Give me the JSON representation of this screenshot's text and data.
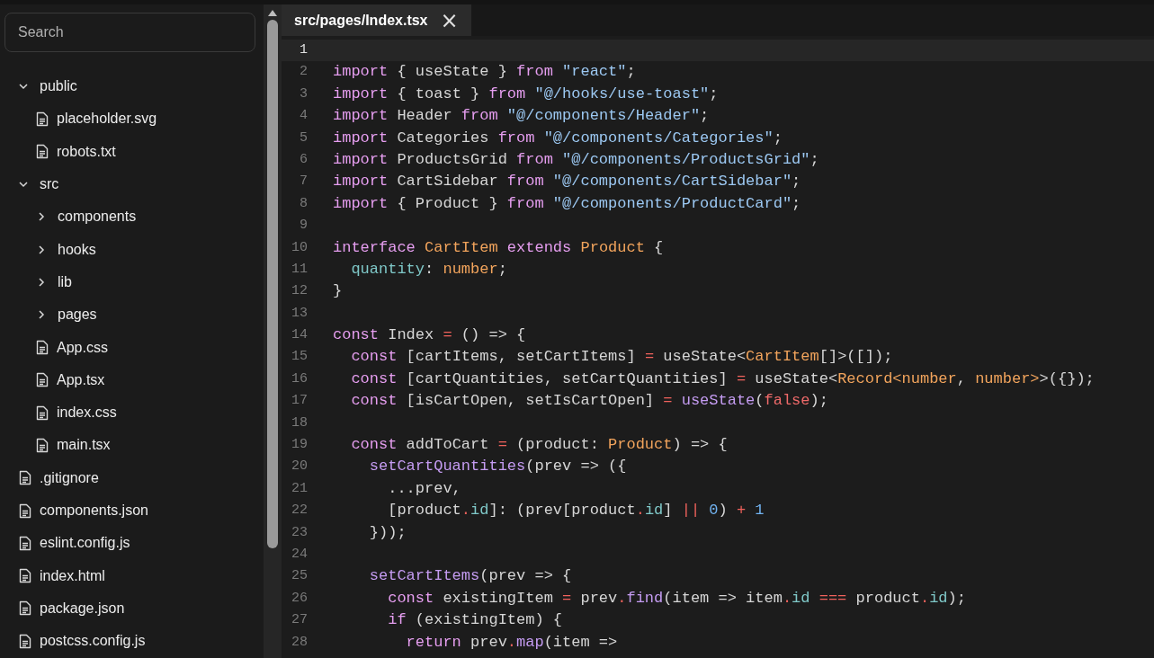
{
  "search": {
    "placeholder": "Search"
  },
  "tree": [
    {
      "kind": "folder",
      "name": "public",
      "expanded": true,
      "children": [
        {
          "kind": "file",
          "name": "placeholder.svg"
        },
        {
          "kind": "file",
          "name": "robots.txt"
        }
      ]
    },
    {
      "kind": "folder",
      "name": "src",
      "expanded": true,
      "children": [
        {
          "kind": "folder",
          "name": "components",
          "expanded": false
        },
        {
          "kind": "folder",
          "name": "hooks",
          "expanded": false
        },
        {
          "kind": "folder",
          "name": "lib",
          "expanded": false
        },
        {
          "kind": "folder",
          "name": "pages",
          "expanded": false
        },
        {
          "kind": "file",
          "name": "App.css"
        },
        {
          "kind": "file",
          "name": "App.tsx"
        },
        {
          "kind": "file",
          "name": "index.css"
        },
        {
          "kind": "file",
          "name": "main.tsx"
        }
      ]
    },
    {
      "kind": "file",
      "name": ".gitignore"
    },
    {
      "kind": "file",
      "name": "components.json"
    },
    {
      "kind": "file",
      "name": "eslint.config.js"
    },
    {
      "kind": "file",
      "name": "index.html"
    },
    {
      "kind": "file",
      "name": "package.json"
    },
    {
      "kind": "file",
      "name": "postcss.config.js"
    }
  ],
  "tabs": [
    {
      "label": "src/pages/Index.tsx",
      "selected": true,
      "close": "×"
    }
  ],
  "lines": [
    {
      "number": "1",
      "selected": true
    },
    {
      "number": "2",
      "selected": false,
      "tokens": [
        {
          "text": "import ",
          "kind": "keyword"
        },
        {
          "text": "{ useState } ",
          "kind": "plain"
        },
        {
          "text": "from ",
          "kind": "keyword"
        },
        {
          "text": "\"react\"",
          "kind": "string"
        },
        {
          "text": ";",
          "kind": "plain"
        }
      ]
    },
    {
      "number": "3",
      "selected": false,
      "tokens": [
        {
          "text": "import ",
          "kind": "keyword"
        },
        {
          "text": "{ toast } ",
          "kind": "plain"
        },
        {
          "text": "from ",
          "kind": "keyword"
        },
        {
          "text": "\"@/hooks/use-toast\"",
          "kind": "string"
        },
        {
          "text": ";",
          "kind": "plain"
        }
      ]
    },
    {
      "number": "4",
      "selected": false,
      "tokens": [
        {
          "text": "import ",
          "kind": "keyword"
        },
        {
          "text": "Header ",
          "kind": "plain"
        },
        {
          "text": "from ",
          "kind": "keyword"
        },
        {
          "text": "\"@/components/Header\"",
          "kind": "string"
        },
        {
          "text": ";",
          "kind": "plain"
        }
      ]
    },
    {
      "number": "5",
      "selected": false,
      "tokens": [
        {
          "text": "import ",
          "kind": "keyword"
        },
        {
          "text": "Categories ",
          "kind": "plain"
        },
        {
          "text": "from ",
          "kind": "keyword"
        },
        {
          "text": "\"@/components/Categories\"",
          "kind": "string"
        },
        {
          "text": ";",
          "kind": "plain"
        }
      ]
    },
    {
      "number": "6",
      "selected": false,
      "tokens": [
        {
          "text": "import ",
          "kind": "keyword"
        },
        {
          "text": "ProductsGrid ",
          "kind": "plain"
        },
        {
          "text": "from ",
          "kind": "keyword"
        },
        {
          "text": "\"@/components/ProductsGrid\"",
          "kind": "string"
        },
        {
          "text": ";",
          "kind": "plain"
        }
      ]
    },
    {
      "number": "7",
      "selected": false,
      "tokens": [
        {
          "text": "import ",
          "kind": "keyword"
        },
        {
          "text": "CartSidebar ",
          "kind": "plain"
        },
        {
          "text": "from ",
          "kind": "keyword"
        },
        {
          "text": "\"@/components/CartSidebar\"",
          "kind": "string"
        },
        {
          "text": ";",
          "kind": "plain"
        }
      ]
    },
    {
      "number": "8",
      "selected": false,
      "tokens": [
        {
          "text": "import ",
          "kind": "keyword"
        },
        {
          "text": "{ Product } ",
          "kind": "plain"
        },
        {
          "text": "from ",
          "kind": "keyword"
        },
        {
          "text": "\"@/components/ProductCard\"",
          "kind": "string"
        },
        {
          "text": ";",
          "kind": "plain"
        }
      ]
    },
    {
      "number": "9",
      "selected": false
    },
    {
      "number": "10",
      "selected": false,
      "tokens": [
        {
          "text": "interface ",
          "kind": "keyword"
        },
        {
          "text": "CartItem ",
          "kind": "type"
        },
        {
          "text": "extends ",
          "kind": "keyword"
        },
        {
          "text": "Product ",
          "kind": "type"
        },
        {
          "text": "{",
          "kind": "plain"
        }
      ]
    },
    {
      "number": "11",
      "selected": false,
      "tokens": [
        {
          "text": "  quantity",
          "kind": "property"
        },
        {
          "text": ": ",
          "kind": "plain"
        },
        {
          "text": "number",
          "kind": "type"
        },
        {
          "text": ";",
          "kind": "plain"
        }
      ]
    },
    {
      "number": "12",
      "selected": false,
      "tokens": [
        {
          "text": "}",
          "kind": "plain"
        }
      ]
    },
    {
      "number": "13",
      "selected": false
    },
    {
      "number": "14",
      "selected": false,
      "tokens": [
        {
          "text": "const",
          "kind": "keyword"
        },
        {
          "text": " Index ",
          "kind": "plain"
        },
        {
          "text": "=",
          "kind": "operator"
        },
        {
          "text": " () => {",
          "kind": "plain"
        }
      ]
    },
    {
      "number": "15",
      "selected": false,
      "tokens": [
        {
          "text": "  const",
          "kind": "keyword"
        },
        {
          "text": " [cartItems, setCartItems] ",
          "kind": "plain"
        },
        {
          "text": "=",
          "kind": "operator"
        },
        {
          "text": " useState<",
          "kind": "plain"
        },
        {
          "text": "CartItem",
          "kind": "type"
        },
        {
          "text": "[]>([]);",
          "kind": "plain"
        }
      ]
    },
    {
      "number": "16",
      "selected": false,
      "tokens": [
        {
          "text": "  const",
          "kind": "keyword"
        },
        {
          "text": " [cartQuantities, setCartQuantities] ",
          "kind": "plain"
        },
        {
          "text": "=",
          "kind": "operator"
        },
        {
          "text": " useState<",
          "kind": "plain"
        },
        {
          "text": "Record<number",
          "kind": "type"
        },
        {
          "text": ", ",
          "kind": "plain"
        },
        {
          "text": "number>",
          "kind": "type"
        },
        {
          "text": ">({});",
          "kind": "plain"
        }
      ]
    },
    {
      "number": "17",
      "selected": false,
      "tokens": [
        {
          "text": "  const",
          "kind": "keyword"
        },
        {
          "text": " [isCartOpen, setIsCartOpen] ",
          "kind": "plain"
        },
        {
          "text": "=",
          "kind": "operator"
        },
        {
          "text": " useState",
          "kind": "function"
        },
        {
          "text": "(",
          "kind": "plain"
        },
        {
          "text": "false",
          "kind": "boolean"
        },
        {
          "text": ");",
          "kind": "plain"
        }
      ]
    },
    {
      "number": "18",
      "selected": false
    },
    {
      "number": "19",
      "selected": false,
      "tokens": [
        {
          "text": "  const",
          "kind": "keyword"
        },
        {
          "text": " addToCart ",
          "kind": "plain"
        },
        {
          "text": "=",
          "kind": "operator"
        },
        {
          "text": " (product: ",
          "kind": "plain"
        },
        {
          "text": "Product",
          "kind": "type"
        },
        {
          "text": ") => {",
          "kind": "plain"
        }
      ]
    },
    {
      "number": "20",
      "selected": false,
      "tokens": [
        {
          "text": "    setCartQuantities",
          "kind": "function"
        },
        {
          "text": "(prev => ({",
          "kind": "plain"
        }
      ]
    },
    {
      "number": "21",
      "selected": false,
      "tokens": [
        {
          "text": "      ...prev,",
          "kind": "plain"
        }
      ]
    },
    {
      "number": "22",
      "selected": false,
      "tokens": [
        {
          "text": "      [product",
          "kind": "plain"
        },
        {
          "text": ".",
          "kind": "operator"
        },
        {
          "text": "id",
          "kind": "property"
        },
        {
          "text": "]: (prev[product",
          "kind": "plain"
        },
        {
          "text": ".",
          "kind": "operator"
        },
        {
          "text": "id",
          "kind": "property"
        },
        {
          "text": "] ",
          "kind": "plain"
        },
        {
          "text": "||",
          "kind": "operator"
        },
        {
          "text": " 0",
          "kind": "number"
        },
        {
          "text": ") ",
          "kind": "plain"
        },
        {
          "text": "+",
          "kind": "operator"
        },
        {
          "text": " 1",
          "kind": "number"
        }
      ]
    },
    {
      "number": "23",
      "selected": false,
      "tokens": [
        {
          "text": "    }));",
          "kind": "plain"
        }
      ]
    },
    {
      "number": "24",
      "selected": false
    },
    {
      "number": "25",
      "selected": false,
      "tokens": [
        {
          "text": "    setCartItems",
          "kind": "function"
        },
        {
          "text": "(prev => {",
          "kind": "plain"
        }
      ]
    },
    {
      "number": "26",
      "selected": false,
      "tokens": [
        {
          "text": "      const",
          "kind": "keyword"
        },
        {
          "text": " existingItem ",
          "kind": "plain"
        },
        {
          "text": "=",
          "kind": "operator"
        },
        {
          "text": " prev",
          "kind": "plain"
        },
        {
          "text": ".",
          "kind": "operator"
        },
        {
          "text": "find",
          "kind": "function"
        },
        {
          "text": "(item => item",
          "kind": "plain"
        },
        {
          "text": ".",
          "kind": "operator"
        },
        {
          "text": "id",
          "kind": "property"
        },
        {
          "text": " ===",
          "kind": "operator"
        },
        {
          "text": " product",
          "kind": "plain"
        },
        {
          "text": ".",
          "kind": "operator"
        },
        {
          "text": "id",
          "kind": "property"
        },
        {
          "text": ");",
          "kind": "plain"
        }
      ]
    },
    {
      "number": "27",
      "selected": false,
      "tokens": [
        {
          "text": "      if",
          "kind": "keyword"
        },
        {
          "text": " (existingItem) {",
          "kind": "plain"
        }
      ]
    },
    {
      "number": "28",
      "selected": false,
      "tokens": [
        {
          "text": "        return",
          "kind": "keyword"
        },
        {
          "text": " prev",
          "kind": "plain"
        },
        {
          "text": ".",
          "kind": "operator"
        },
        {
          "text": "map",
          "kind": "function"
        },
        {
          "text": "(item =>",
          "kind": "plain"
        }
      ]
    }
  ]
}
